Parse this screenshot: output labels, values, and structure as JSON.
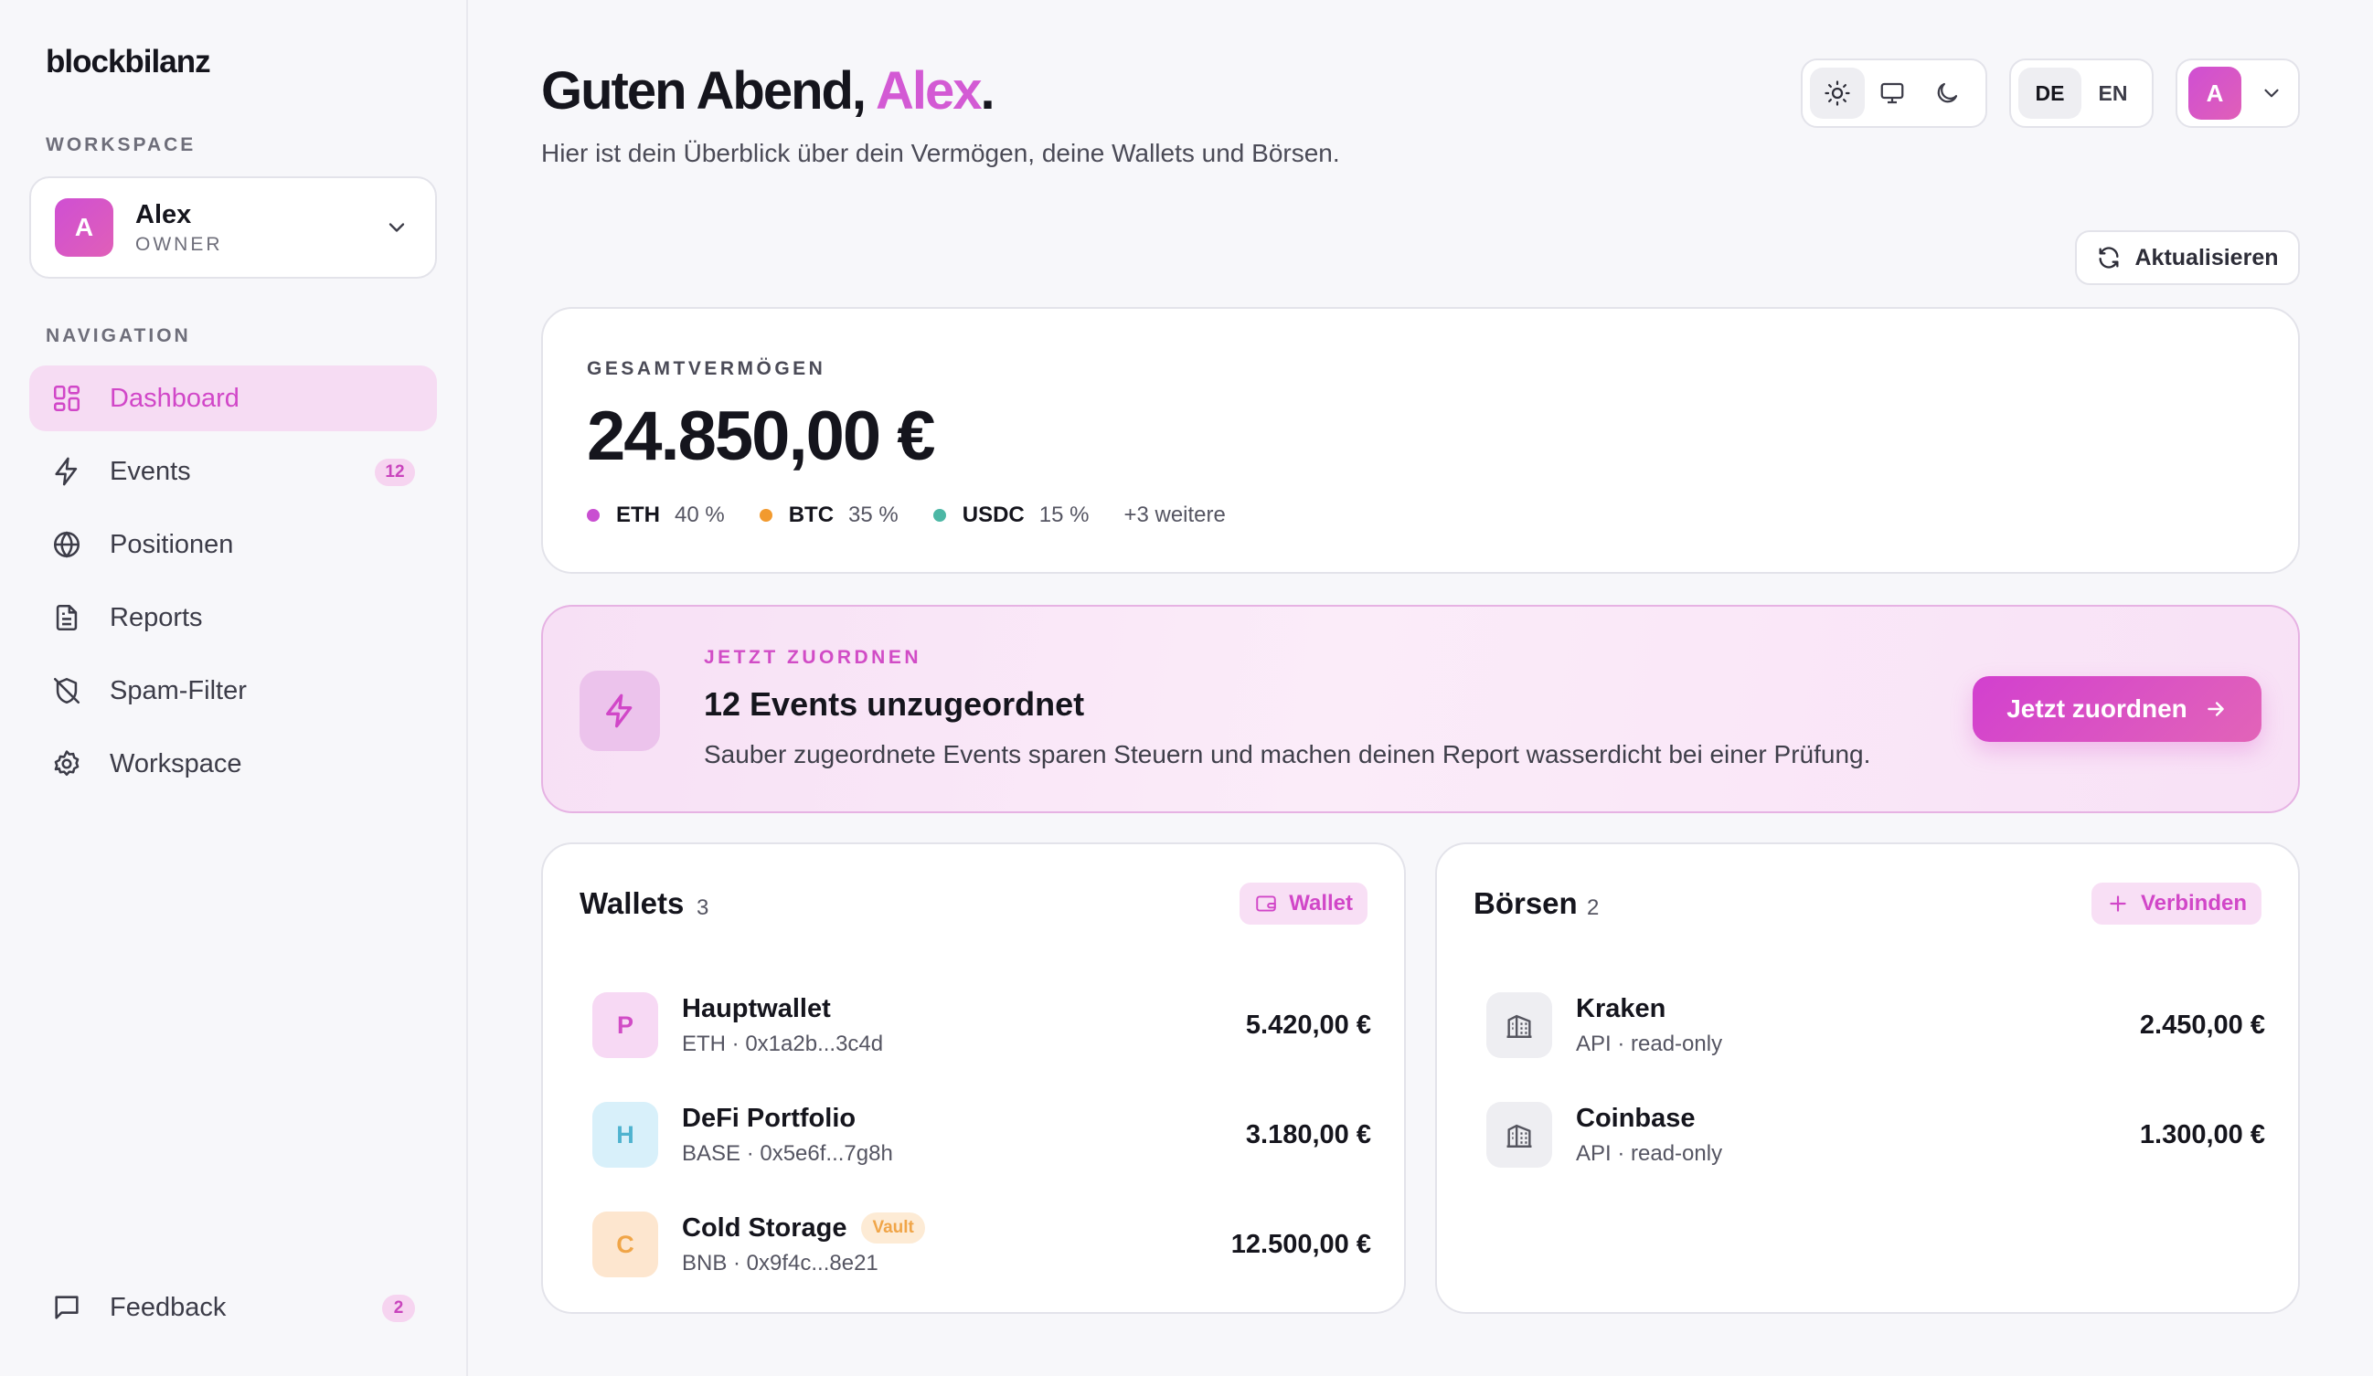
{
  "brand": "blockbilanz",
  "colors": {
    "accent": "#d147c8",
    "eth": "#c94fd1",
    "btc": "#f29a2e",
    "usdc": "#4cb7a5"
  },
  "sidebar": {
    "workspace_label": "WORKSPACE",
    "workspace": {
      "avatar": "A",
      "name": "Alex",
      "role": "OWNER"
    },
    "nav_label": "NAVIGATION",
    "items": [
      {
        "label": "Dashboard",
        "icon": "layout-grid-icon",
        "active": true
      },
      {
        "label": "Events",
        "icon": "zap-icon",
        "badge": "12"
      },
      {
        "label": "Positionen",
        "icon": "globe-icon"
      },
      {
        "label": "Reports",
        "icon": "document-icon"
      },
      {
        "label": "Spam-Filter",
        "icon": "shield-off-icon"
      },
      {
        "label": "Workspace",
        "icon": "gear-icon"
      }
    ],
    "feedback": {
      "label": "Feedback",
      "icon": "message-icon",
      "badge": "2"
    }
  },
  "header": {
    "greeting_prefix": "Guten Abend, ",
    "greeting_name": "Alex",
    "greeting_suffix": ".",
    "subtitle": "Hier ist dein Überblick über dein Vermögen, deine Wallets und Börsen.",
    "theme_selected": "light",
    "languages": [
      "DE",
      "EN"
    ],
    "language_selected": "DE",
    "user_avatar": "A",
    "refresh_label": "Aktualisieren"
  },
  "total": {
    "label": "GESAMTVERMÖGEN",
    "value": "24.850,00 €",
    "allocation": [
      {
        "symbol": "ETH",
        "pct": "40 %"
      },
      {
        "symbol": "BTC",
        "pct": "35 %"
      },
      {
        "symbol": "USDC",
        "pct": "15 %"
      }
    ],
    "more": "+3 weitere"
  },
  "banner": {
    "eyebrow": "JETZT ZUORDNEN",
    "title": "12 Events unzugeordnet",
    "description": "Sauber zugeordnete Events sparen Steuern und machen deinen Report wasserdicht bei einer Prüfung.",
    "cta": "Jetzt zuordnen"
  },
  "wallets": {
    "title": "Wallets",
    "count": "3",
    "button": "Wallet",
    "items": [
      {
        "initial": "P",
        "name": "Hauptwallet",
        "sub": "ETH · 0x1a2b...3c4d",
        "value": "5.420,00 €"
      },
      {
        "initial": "H",
        "name": "DeFi Portfolio",
        "sub": "BASE · 0x5e6f...7g8h",
        "value": "3.180,00 €"
      },
      {
        "initial": "C",
        "name": "Cold Storage",
        "tag": "Vault",
        "sub": "BNB · 0x9f4c...8e21",
        "value": "12.500,00 €"
      }
    ]
  },
  "exchanges": {
    "title": "Börsen",
    "count": "2",
    "button": "Verbinden",
    "items": [
      {
        "name": "Kraken",
        "sub": "API · read-only",
        "value": "2.450,00 €"
      },
      {
        "name": "Coinbase",
        "sub": "API · read-only",
        "value": "1.300,00 €"
      }
    ]
  }
}
